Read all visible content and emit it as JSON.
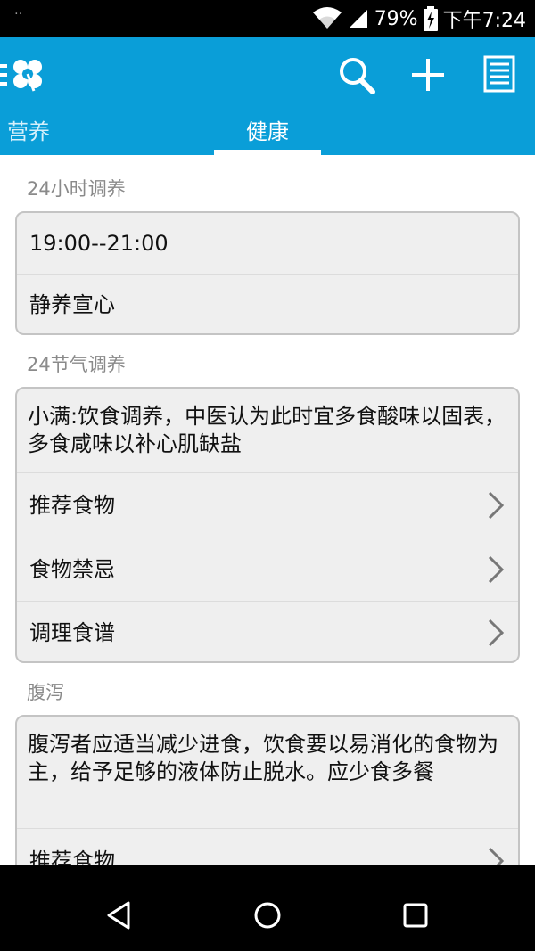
{
  "status_bar": {
    "left_indicator": "‥",
    "battery": "79%",
    "time": "下午7:24"
  },
  "app_bar": {
    "logo_icon": "clover-logo-icon",
    "actions": [
      "search-icon",
      "add-icon",
      "menu-list-icon"
    ],
    "tabs": [
      {
        "label": "营养",
        "selected": false
      },
      {
        "label": "健康",
        "selected": true
      }
    ],
    "colors": {
      "primary": "#0a9ed8",
      "indicator": "#ffffff"
    }
  },
  "sections": {
    "hours": {
      "title": "24小时调养",
      "time_range": "19:00--21:00",
      "advice": "静养宣心"
    },
    "solar_terms": {
      "title": "24节气调养",
      "summary": "小满:饮食调养，中医认为此时宜多食酸味以固表，多食咸味以补心肌缺盐",
      "items": [
        "推荐食物",
        "食物禁忌",
        "调理食谱"
      ]
    },
    "diarrhea": {
      "title": "腹泻",
      "summary": "腹泻者应适当减少进食，饮食要以易消化的食物为主，给予足够的液体防止脱水。应少食多餐",
      "items": [
        "推荐食物"
      ]
    }
  },
  "nav_bar": {
    "buttons": [
      "back-icon",
      "home-icon",
      "recents-icon"
    ]
  }
}
